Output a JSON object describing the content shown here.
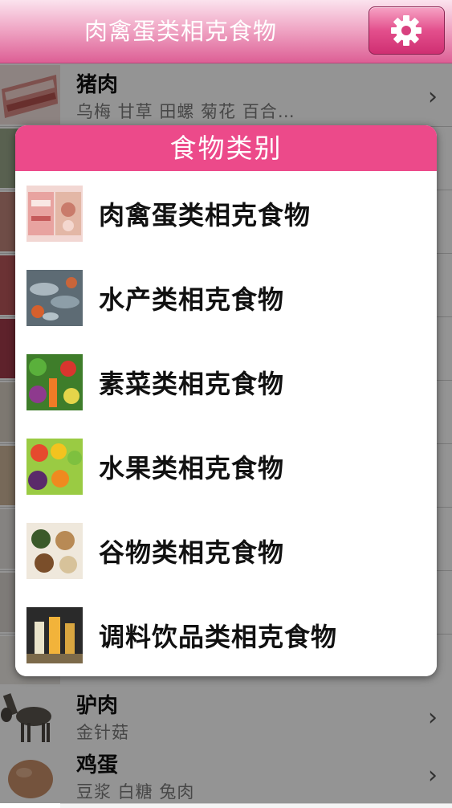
{
  "navbar": {
    "title": "肉禽蛋类相克食物",
    "settings_icon": "gear-icon"
  },
  "list": {
    "top_item": {
      "name": "猪肉",
      "tags": "乌梅   甘草    田螺    菊花    百合…"
    },
    "bottom_items": [
      {
        "name": "驴肉",
        "tags": "金针菇"
      },
      {
        "name": "鸡蛋",
        "tags": "豆浆   白糖    兔肉"
      }
    ]
  },
  "popup": {
    "title": "食物类别",
    "categories": [
      {
        "label": "肉禽蛋类相克食物",
        "icon": "meat-image"
      },
      {
        "label": "水产类相克食物",
        "icon": "seafood-image"
      },
      {
        "label": "素菜类相克食物",
        "icon": "vegetables-image"
      },
      {
        "label": "水果类相克食物",
        "icon": "fruit-image"
      },
      {
        "label": "谷物类相克食物",
        "icon": "grains-image"
      },
      {
        "label": "调料饮品类相克食物",
        "icon": "drinks-image"
      }
    ]
  },
  "colors": {
    "accent": "#ec4a8a",
    "navbar_bottom": "#dd5f95"
  }
}
